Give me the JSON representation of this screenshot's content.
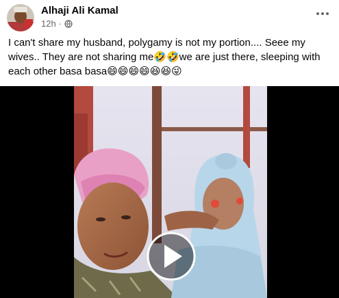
{
  "post": {
    "author": "Alhaji Ali Kamal",
    "time": "12h",
    "separator": "·",
    "audience_icon": "globe-icon",
    "menu_icon": "more-options-icon",
    "text": "I can't share my husband, polygamy is not my portion.... Seee my wives.. They are not sharing me🤣🤣we are just there, sleeping with each other basa basa😄😄😄😄😆😆😜"
  },
  "video": {
    "play_icon": "play-icon"
  }
}
